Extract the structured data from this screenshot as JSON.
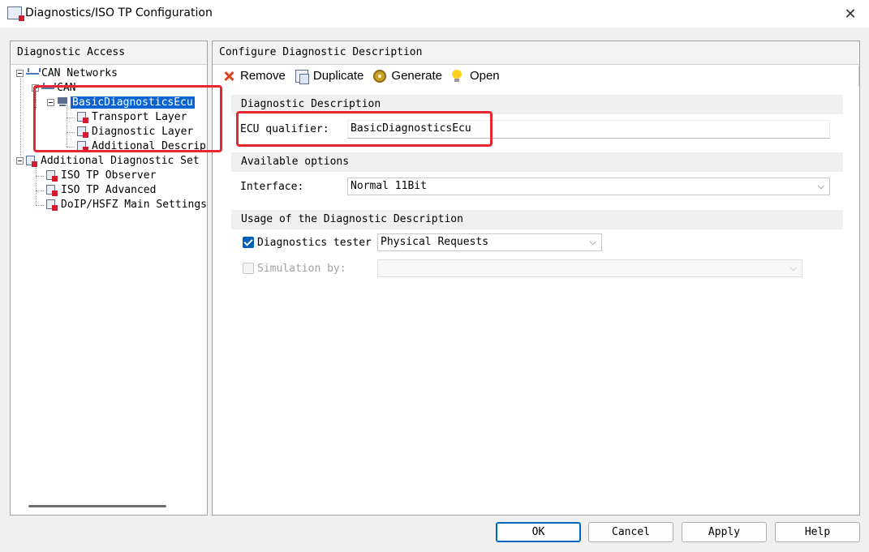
{
  "window": {
    "title": "Diagnostics/ISO TP Configuration",
    "close_glyph": "✕"
  },
  "left": {
    "header": "Diagnostic Access",
    "tree": [
      {
        "label": "CAN Networks",
        "icon": "network-icon"
      },
      {
        "label": "CAN",
        "icon": "network-icon"
      },
      {
        "label": "BasicDiagnosticsEcu",
        "icon": "ecu-icon",
        "selected": true
      },
      {
        "label": "Transport Layer",
        "icon": "document-icon"
      },
      {
        "label": "Diagnostic Layer",
        "icon": "document-icon"
      },
      {
        "label": "Additional Descrip",
        "icon": "document-icon"
      },
      {
        "label": "Additional Diagnostic Set",
        "icon": "document-icon"
      },
      {
        "label": "ISO TP Observer",
        "icon": "document-icon"
      },
      {
        "label": "ISO TP Advanced",
        "icon": "document-icon"
      },
      {
        "label": "DoIP/HSFZ Main Settings",
        "icon": "document-icon"
      }
    ]
  },
  "right": {
    "header": "Configure Diagnostic Description",
    "toolbar": {
      "remove": "Remove",
      "duplicate": "Duplicate",
      "generate": "Generate",
      "open": "Open"
    },
    "sections": {
      "description": "Diagnostic Description",
      "options": "Available options",
      "usage": "Usage of the Diagnostic Description"
    },
    "ecu_qualifier_label": "ECU qualifier:",
    "ecu_qualifier_value": "BasicDiagnosticsEcu",
    "interface_label": "Interface:",
    "interface_value": "Normal 11Bit",
    "tester_label": "Diagnostics tester",
    "tester_checked": true,
    "tester_value": "Physical Requests",
    "simulation_label": "Simulation by:",
    "simulation_checked": false,
    "simulation_value": ""
  },
  "buttons": {
    "ok": "OK",
    "cancel": "Cancel",
    "apply": "Apply",
    "help": "Help"
  },
  "colors": {
    "selection": "#0a64d2",
    "highlight_box": "#e8262f",
    "checkbox_on": "#005fb8"
  }
}
